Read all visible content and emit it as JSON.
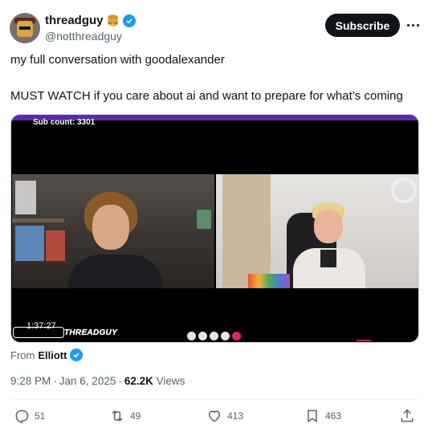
{
  "author": {
    "display_name": "threadguy",
    "emoji": "🍔",
    "handle": "@notthreadguy",
    "verified": true
  },
  "subscribe_label": "Subscribe",
  "tweet": {
    "line1": "my full conversation with goodalexander",
    "line2": "MUST WATCH if you care about ai and want to prepare for what’s coming"
  },
  "video": {
    "sub_count": "Sub count: 3301",
    "timestamp": "1:37:27",
    "logo": "THREADGUY"
  },
  "from": {
    "label": "From",
    "name": "Elliott"
  },
  "meta": {
    "time": "9:28 PM",
    "date": "Jan 6, 2025",
    "views_count": "62.2K",
    "views_label": "Views"
  },
  "actions": {
    "replies": "51",
    "reposts": "49",
    "likes": "413",
    "bookmarks": "463"
  },
  "colors": {
    "accent": "#1d9bf0",
    "text": "#0f1419",
    "muted": "#536471",
    "button_bg": "#0f1419"
  },
  "icons": [
    "verified-badge-icon",
    "more-icon",
    "reply-icon",
    "repost-icon",
    "like-icon",
    "bookmark-icon",
    "share-icon"
  ]
}
